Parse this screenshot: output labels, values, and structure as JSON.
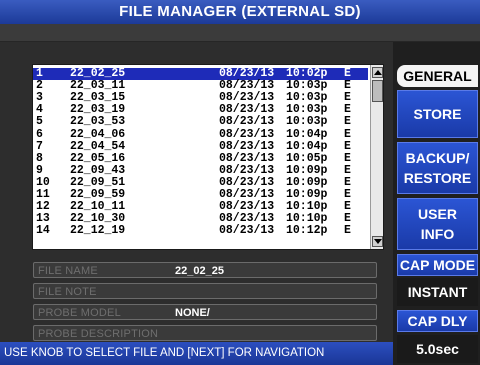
{
  "window": {
    "title": "FILE MANAGER (EXTERNAL SD)"
  },
  "file_list": {
    "rows": [
      {
        "index": "1",
        "name": "22_02_25",
        "date": "08/23/13",
        "time": "10:02p",
        "type": "E",
        "selected": true
      },
      {
        "index": "2",
        "name": "22_03_11",
        "date": "08/23/13",
        "time": "10:03p",
        "type": "E"
      },
      {
        "index": "3",
        "name": "22_03_15",
        "date": "08/23/13",
        "time": "10:03p",
        "type": "E"
      },
      {
        "index": "4",
        "name": "22_03_19",
        "date": "08/23/13",
        "time": "10:03p",
        "type": "E"
      },
      {
        "index": "5",
        "name": "22_03_53",
        "date": "08/23/13",
        "time": "10:03p",
        "type": "E"
      },
      {
        "index": "6",
        "name": "22_04_06",
        "date": "08/23/13",
        "time": "10:04p",
        "type": "E"
      },
      {
        "index": "7",
        "name": "22_04_54",
        "date": "08/23/13",
        "time": "10:04p",
        "type": "E"
      },
      {
        "index": "8",
        "name": "22_05_16",
        "date": "08/23/13",
        "time": "10:05p",
        "type": "E"
      },
      {
        "index": "9",
        "name": "22_09_43",
        "date": "08/23/13",
        "time": "10:09p",
        "type": "E"
      },
      {
        "index": "10",
        "name": "22_09_51",
        "date": "08/23/13",
        "time": "10:09p",
        "type": "E"
      },
      {
        "index": "11",
        "name": "22_09_59",
        "date": "08/23/13",
        "time": "10:09p",
        "type": "E"
      },
      {
        "index": "12",
        "name": "22_10_11",
        "date": "08/23/13",
        "time": "10:10p",
        "type": "E"
      },
      {
        "index": "13",
        "name": "22_10_30",
        "date": "08/23/13",
        "time": "10:10p",
        "type": "E"
      },
      {
        "index": "14",
        "name": "22_12_19",
        "date": "08/23/13",
        "time": "10:12p",
        "type": "E"
      }
    ]
  },
  "fields": {
    "file_name": {
      "label": "FILE NAME",
      "value": "22_02_25"
    },
    "file_note": {
      "label": "FILE NOTE",
      "value": ""
    },
    "probe_model": {
      "label": "PROBE MODEL",
      "value": "NONE/"
    },
    "probe_description": {
      "label": "PROBE DESCRIPTION",
      "value": ""
    }
  },
  "status_bar": {
    "text": "USE KNOB TO SELECT FILE AND [NEXT] FOR NAVIGATION"
  },
  "menu": {
    "general": "GENERAL",
    "store": "STORE",
    "backup_line1": "BACKUP/",
    "backup_line2": "RESTORE",
    "user_line1": "USER",
    "user_line2": "INFO",
    "cap_mode_label": "CAP MODE",
    "cap_mode_value": "INSTANT",
    "cap_dly_label": "CAP DLY",
    "cap_dly_value": "5.0sec"
  },
  "colors": {
    "title_bar": "#1c3a98",
    "selection": "#1e2bb8",
    "menu_button": "#1a3aa8"
  }
}
